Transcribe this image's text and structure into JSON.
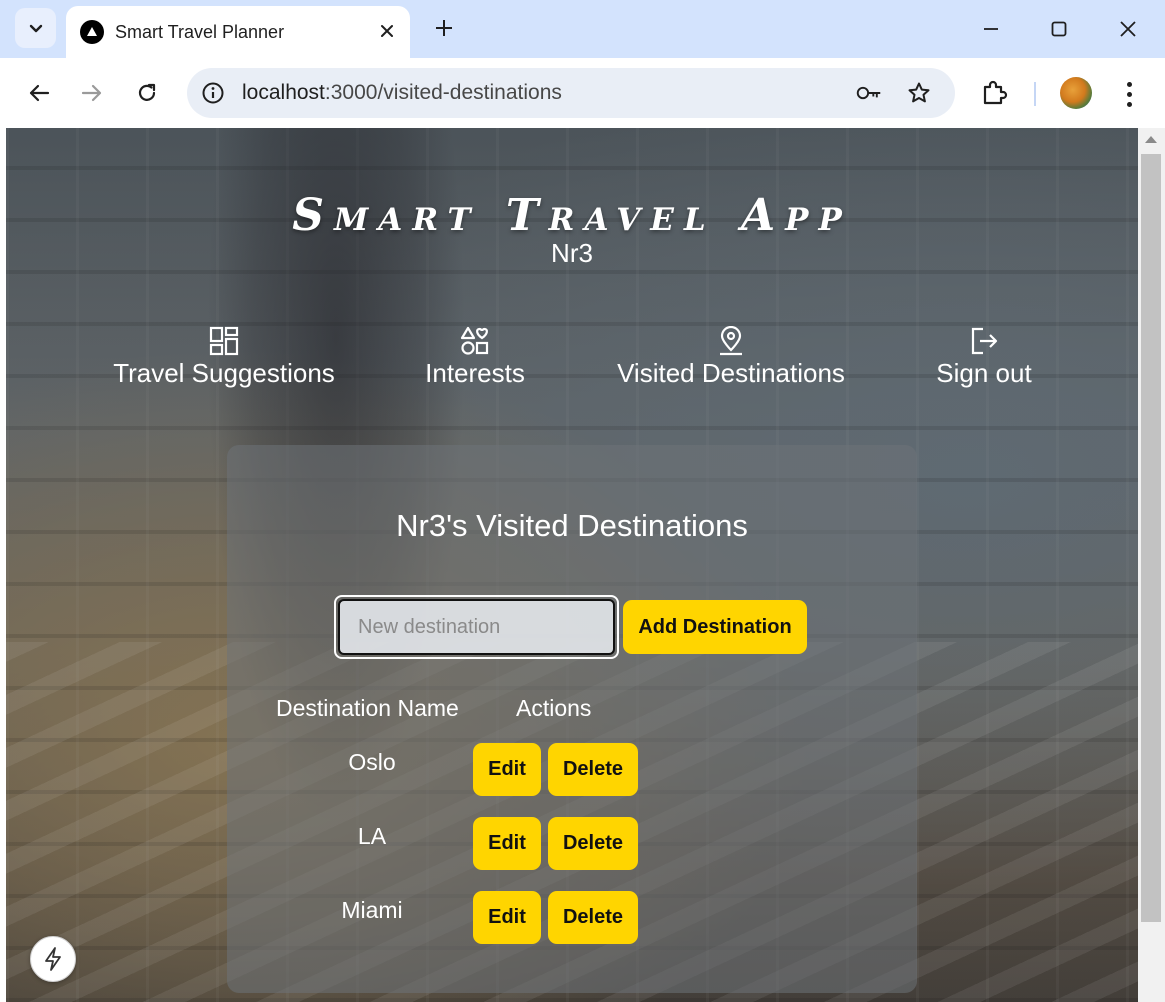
{
  "browser": {
    "tab_title": "Smart Travel Planner",
    "url_host": "localhost",
    "url_path": ":3000/visited-destinations"
  },
  "app": {
    "title": "Smart Travel App",
    "subtitle": "Nr3"
  },
  "nav": {
    "items": [
      {
        "label": "Travel Suggestions",
        "icon": "dashboard-icon"
      },
      {
        "label": "Interests",
        "icon": "shapes-icon"
      },
      {
        "label": "Visited Destinations",
        "icon": "map-pin-icon"
      },
      {
        "label": "Sign out",
        "icon": "sign-out-icon"
      }
    ]
  },
  "card": {
    "title": "Nr3's Visited Destinations",
    "input_placeholder": "New destination",
    "add_label": "Add Destination",
    "col_name": "Destination Name",
    "col_actions": "Actions",
    "edit_label": "Edit",
    "delete_label": "Delete",
    "rows": [
      {
        "name": "Oslo"
      },
      {
        "name": "LA"
      },
      {
        "name": "Miami"
      }
    ]
  },
  "colors": {
    "accent": "#ffd500",
    "chrome_tabbar": "#d3e3fd",
    "omnibox": "#e9eef6"
  }
}
